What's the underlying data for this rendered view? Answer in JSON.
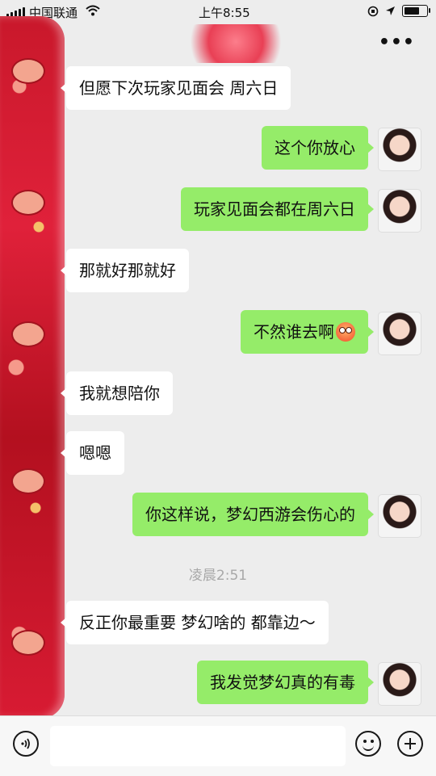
{
  "status_bar": {
    "carrier": "中国联通",
    "time": "上午8:55",
    "battery_level": 0.8
  },
  "header": {
    "more_label": "•••"
  },
  "messages": [
    {
      "dir": "in",
      "text": "但愿下次玩家见面会 周六日"
    },
    {
      "dir": "out",
      "text": "这个你放心"
    },
    {
      "dir": "out",
      "text": "玩家见面会都在周六日"
    },
    {
      "dir": "in",
      "text": "那就好那就好"
    },
    {
      "dir": "out",
      "text": "不然谁去啊",
      "emoji": "flushed-face"
    },
    {
      "dir": "in",
      "text": "我就想陪你"
    },
    {
      "dir": "in",
      "text": "嗯嗯"
    },
    {
      "dir": "out",
      "text": "你这样说，梦幻西游会伤心的"
    },
    {
      "dir": "in",
      "text": "反正你最重要 梦幻啥的 都靠边～"
    },
    {
      "dir": "out",
      "text": "我发觉梦幻真的有毒"
    }
  ],
  "timestamp": "凌晨2:51",
  "input_bar": {
    "voice_icon": "voice-icon",
    "emoji_icon": "emoji-icon",
    "plus_icon": "plus-icon",
    "value": ""
  },
  "colors": {
    "background": "#ededed",
    "outgoing_bubble": "#95ec69",
    "incoming_bubble": "#ffffff",
    "decoration_red": "#d81b33"
  }
}
